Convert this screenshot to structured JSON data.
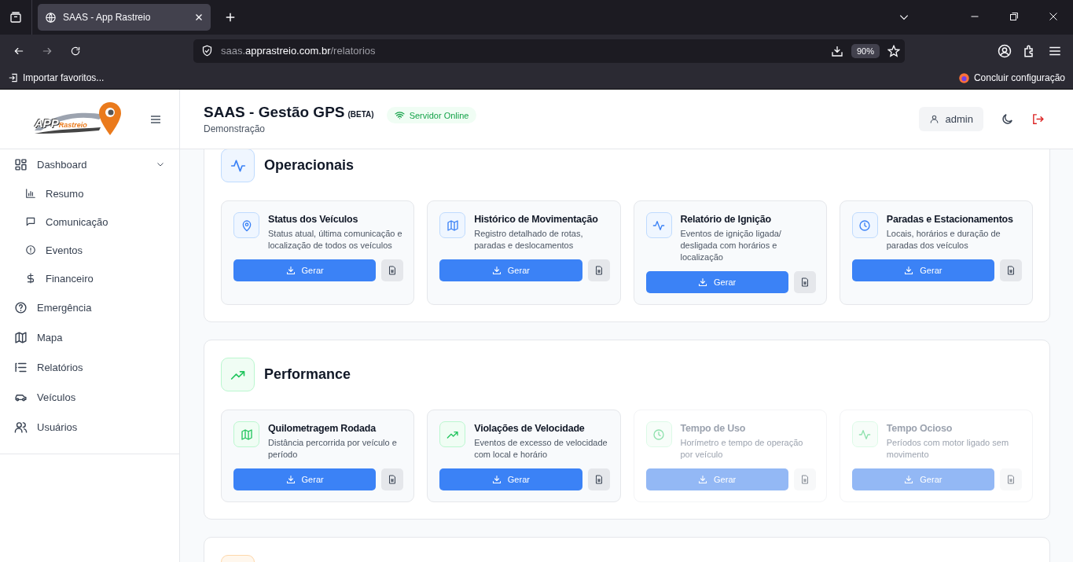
{
  "browser": {
    "tab_title": "SAAS - App Rastreio",
    "url": {
      "prefix": "saas.",
      "domain": "apprastreio.com.br",
      "path": "/relatorios"
    },
    "zoom": "90%",
    "bookmarks": [
      "Importar favoritos..."
    ],
    "setup_link": "Concluir configuração"
  },
  "logo": {
    "word_1": "APP",
    "word_2": "Rastreio"
  },
  "sidebar": {
    "items": [
      {
        "label": "Dashboard",
        "expanded": true,
        "children": [
          {
            "label": "Resumo"
          },
          {
            "label": "Comunicação"
          },
          {
            "label": "Eventos"
          },
          {
            "label": "Financeiro"
          }
        ]
      },
      {
        "label": "Emergência"
      },
      {
        "label": "Mapa"
      },
      {
        "label": "Relatórios"
      },
      {
        "label": "Veículos"
      },
      {
        "label": "Usuários"
      }
    ]
  },
  "header": {
    "title": "SAAS - Gestão GPS",
    "badge": "(BETA)",
    "subtitle": "Demonstração",
    "status": "Servidor Online",
    "user": "admin"
  },
  "sections": [
    {
      "title": "Operacionais",
      "reports": [
        {
          "title": "Status dos Veículos",
          "description": "Status atual, última comunicação e localização de todos os veículos",
          "button": "Gerar",
          "disabled": false
        },
        {
          "title": "Histórico de Movimentação",
          "description": "Registro detalhado de rotas, paradas e deslocamentos",
          "button": "Gerar",
          "disabled": false
        },
        {
          "title": "Relatório de Ignição",
          "description": "Eventos de ignição ligada/ desligada com horários e localização",
          "button": "Gerar",
          "disabled": false
        },
        {
          "title": "Paradas e Estacionamentos",
          "description": "Locais, horários e duração de paradas dos veículos",
          "button": "Gerar",
          "disabled": false
        }
      ]
    },
    {
      "title": "Performance",
      "reports": [
        {
          "title": "Quilometragem Rodada",
          "description": "Distância percorrida por veículo e período",
          "button": "Gerar",
          "disabled": false
        },
        {
          "title": "Violações de Velocidade",
          "description": "Eventos de excesso de velocidade com local e horário",
          "button": "Gerar",
          "disabled": false
        },
        {
          "title": "Tempo de Uso",
          "description": "Horímetro e tempo de operação por veículo",
          "button": "Gerar",
          "disabled": true
        },
        {
          "title": "Tempo Ocioso",
          "description": "Períodos com motor ligado sem movimento",
          "button": "Gerar",
          "disabled": true
        }
      ]
    }
  ]
}
